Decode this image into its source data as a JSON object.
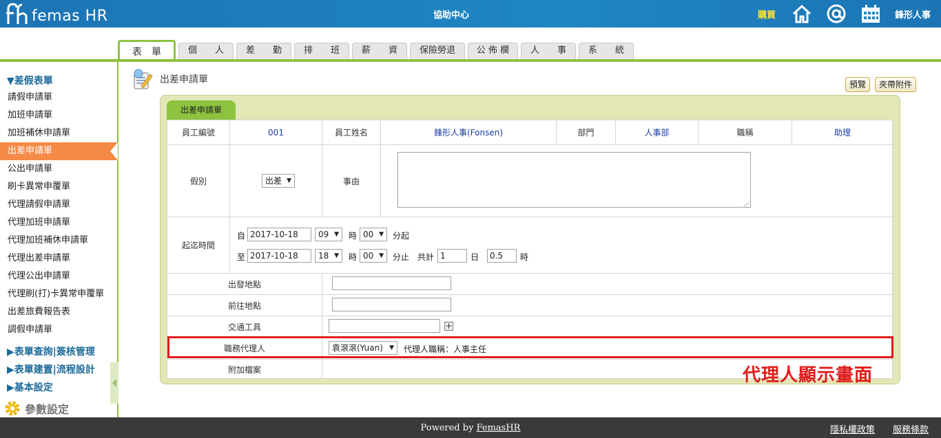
{
  "header": {
    "brand": "femas HR",
    "center_title": "協助中心",
    "buy": "購買",
    "company": "鋒形人事"
  },
  "tabs": [
    {
      "label": "表　單",
      "active": true
    },
    {
      "label": "個　　人"
    },
    {
      "label": "差　　勤"
    },
    {
      "label": "排　　班"
    },
    {
      "label": "薪　　資"
    },
    {
      "label": "保險勞退"
    },
    {
      "label": "公 佈 欄"
    },
    {
      "label": "人　　事"
    },
    {
      "label": "系　　統"
    }
  ],
  "sidebar": {
    "section_main": "▼差假表單",
    "items": [
      "請假申請單",
      "加班申請單",
      "加班補休申請單",
      "出差申請單",
      "公出申請單",
      "刷卡異常申覆單",
      "代理請假申請單",
      "代理加班申請單",
      "代理加班補休申請單",
      "代理出差申請單",
      "代理公出申請單",
      "代理刷(打)卡異常申覆單",
      "出差旅費報告表",
      "調假申請單"
    ],
    "section_query": "▶表單查詢|簽核管理",
    "section_build": "▶表單建置|流程設計",
    "section_basic": "▶基本設定",
    "param": "參數設定"
  },
  "page": {
    "title": "出差申請單",
    "preview_label": "預覽",
    "attach_label": "夾帶附件",
    "panel_tab": "出差申請單"
  },
  "form": {
    "emp_no_label": "員工編號",
    "emp_no": "001",
    "emp_name_label": "員工姓名",
    "emp_name": "鋒形人事(Fonsen)",
    "dept_label": "部門",
    "dept": "人事部",
    "title_label": "職稱",
    "title": "助理",
    "leave_type_label": "假別",
    "leave_type": "出差",
    "reason_label": "事由",
    "period_label": "起迄時間",
    "from_label": "自",
    "from_date": "2017-10-18",
    "from_hour": "09",
    "hour_label": "時",
    "from_min": "00",
    "from_min_label": "分起",
    "to_label": "至",
    "to_date": "2017-10-18",
    "to_hour": "18",
    "to_min": "00",
    "to_min_label": "分止",
    "total_label": "共計",
    "days": "1",
    "day_label": "日",
    "hours": "0.5",
    "hours_label": "時",
    "depart_label": "出發地點",
    "dest_label": "前往地點",
    "transport_label": "交通工具",
    "agent_label": "職務代理人",
    "agent": "袁滾滾(Yuan)",
    "agent_title_text": "代理人職稱：人事主任",
    "attach_row_label": "附加檔案"
  },
  "annotation": "代理人顯示畫面",
  "footer": {
    "powered_prefix": "Powered by ",
    "powered_link": "FemasHR",
    "privacy": "隱私權政策",
    "terms": "服務條款"
  },
  "colors": {
    "topbar": "#1f86c3",
    "accent_green": "#8dc33e",
    "active_orange": "#f58a46",
    "highlight_red": "#e11b1b",
    "panel_bg": "#e3e7b6"
  }
}
